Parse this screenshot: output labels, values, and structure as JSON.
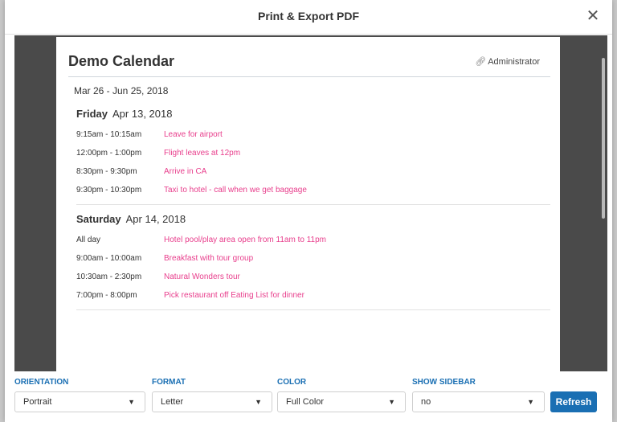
{
  "dialog": {
    "title": "Print & Export PDF",
    "close_icon": "close-icon"
  },
  "calendar": {
    "title": "Demo Calendar",
    "owner": "Administrator",
    "date_range": "Mar 26 - Jun 25, 2018",
    "days": [
      {
        "day_name": "Friday",
        "date": "Apr 13, 2018",
        "events": [
          {
            "time": "9:15am - 10:15am",
            "title": "Leave for airport"
          },
          {
            "time": "12:00pm - 1:00pm",
            "title": "Flight leaves at 12pm"
          },
          {
            "time": "8:30pm - 9:30pm",
            "title": "Arrive in CA"
          },
          {
            "time": "9:30pm - 10:30pm",
            "title": "Taxi to hotel - call when we get baggage"
          }
        ]
      },
      {
        "day_name": "Saturday",
        "date": "Apr 14, 2018",
        "events": [
          {
            "time": "All day",
            "title": "Hotel pool/play area open from 11am to 11pm"
          },
          {
            "time": "9:00am - 10:00am",
            "title": "Breakfast with tour group"
          },
          {
            "time": "10:30am - 2:30pm",
            "title": "Natural Wonders tour"
          },
          {
            "time": "7:00pm - 8:00pm",
            "title": "Pick restaurant off Eating List for dinner"
          }
        ]
      }
    ]
  },
  "controls": {
    "orientation": {
      "label": "ORIENTATION",
      "value": "Portrait"
    },
    "format": {
      "label": "FORMAT",
      "value": "Letter"
    },
    "color": {
      "label": "COLOR",
      "value": "Full Color"
    },
    "sidebar": {
      "label": "SHOW SIDEBAR",
      "value": "no"
    },
    "refresh_label": "Refresh"
  },
  "colors": {
    "accent": "#1a6fb3",
    "event_text": "#e83e8c"
  }
}
